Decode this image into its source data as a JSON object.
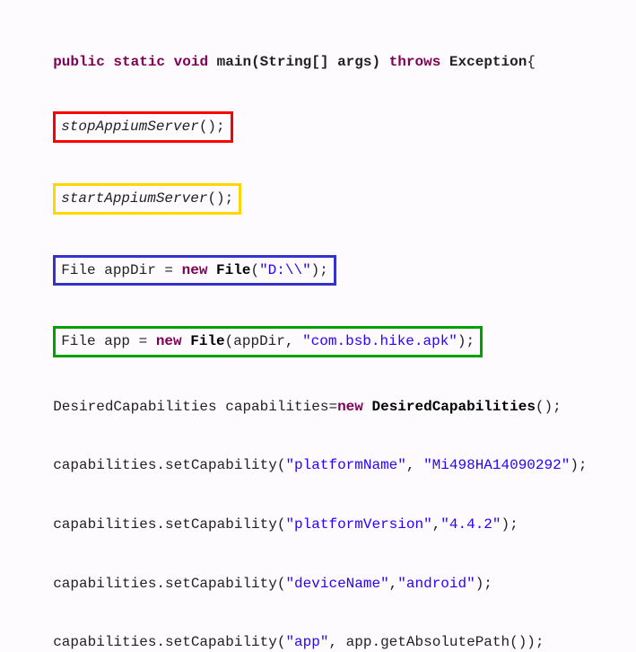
{
  "sig": {
    "public": "public",
    "static": "static",
    "void": "void",
    "main": "main",
    "params_open": "(String[] args)",
    "throws": "throws",
    "exception": "Exception",
    "brace": "{"
  },
  "l1": {
    "call": "stopAppiumServer",
    "after": "();"
  },
  "l2": {
    "call": "startAppiumServer",
    "after": "();"
  },
  "l3": {
    "type1": "File",
    "var": " appDir = ",
    "new": "new",
    "sp": " ",
    "type2": "File",
    "open": "(",
    "str": "\"D:\\\\\"",
    "close": ");"
  },
  "l4": {
    "type1": "File",
    "var": " app = ",
    "new": "new",
    "sp": " ",
    "type2": "File",
    "open": "(appDir, ",
    "str": "\"com.bsb.hike.apk\"",
    "close": ");"
  },
  "l5": {
    "type1": "DesiredCapabilities",
    "var": " capabilities=",
    "new": "new",
    "sp": " ",
    "type2": "DesiredCapabilities",
    "close": "();"
  },
  "l6": {
    "pre": "capabilities.setCapability(",
    "s1": "\"platformName\"",
    "mid": ", ",
    "s2": "\"Mi498HA14090292\"",
    "close": ");"
  },
  "l7": {
    "pre": "capabilities.setCapability(",
    "s1": "\"platformVersion\"",
    "mid": ",",
    "s2": "\"4.4.2\"",
    "close": ");"
  },
  "l8": {
    "pre": "capabilities.setCapability(",
    "s1": "\"deviceName\"",
    "mid": ",",
    "s2": "\"android\"",
    "close": ");"
  },
  "l9": {
    "pre": "capabilities.setCapability(",
    "s1": "\"app\"",
    "mid": ", app.getAbsolutePath());"
  }
}
